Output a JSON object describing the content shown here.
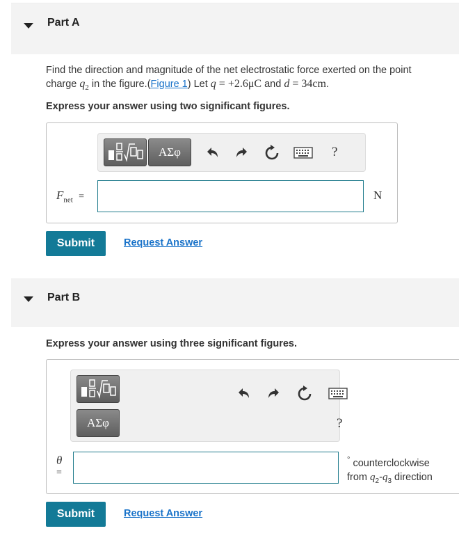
{
  "partA": {
    "title": "Part A",
    "question_pre": "Find the direction and magnitude of the net electrostatic force exerted on the point",
    "question_line2_a": "charge ",
    "q2_base": "q",
    "q2_sub": "2",
    "question_line2_b": " in the figure.(",
    "figure_link": "Figure 1",
    "question_line2_c": ") Let ",
    "q_var": "q",
    "q_value": " = +2.6μC",
    "and": " and ",
    "d_var": "d",
    "d_value": " = 34cm",
    "period": ".",
    "instruction": "Express your answer using two significant figures.",
    "answer_label_base": "F",
    "answer_label_sub": "net",
    "equals": "=",
    "input_value": "",
    "unit": "N",
    "submit_label": "Submit",
    "request_label": "Request Answer",
    "greek_btn": "ΑΣφ",
    "help": "?"
  },
  "partB": {
    "title": "Part B",
    "instruction": "Express your answer using three significant figures.",
    "answer_label": "θ",
    "equals": "=",
    "input_value": "",
    "after_line1": "counterclockwise",
    "after_degree": "°",
    "after_line2_a": "from ",
    "after_q2_base": "q",
    "after_q2_sub": "2",
    "after_dash": "-",
    "after_q3_base": "q",
    "after_q3_sub": "3",
    "after_line2_b": " direction",
    "submit_label": "Submit",
    "request_label": "Request Answer",
    "greek_btn": "ΑΣφ",
    "help": "?"
  },
  "icons": [
    "caret-down-icon",
    "templates-icon",
    "undo-icon",
    "redo-icon",
    "reset-icon",
    "keyboard-icon",
    "help-icon"
  ]
}
